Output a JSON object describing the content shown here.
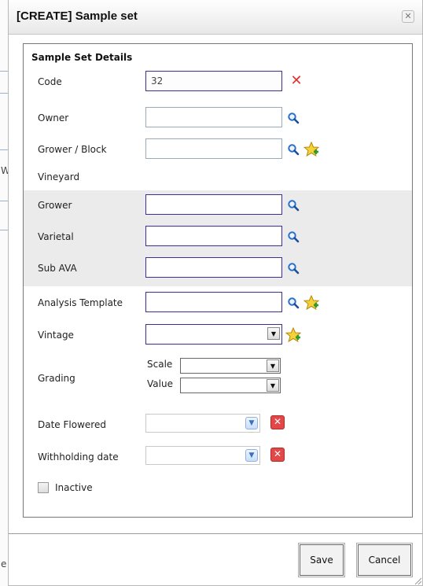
{
  "dialog": {
    "title": "[CREATE] Sample set",
    "section_title": "Sample Set Details"
  },
  "fields": {
    "code": {
      "label": "Code",
      "value": "32"
    },
    "owner": {
      "label": "Owner",
      "value": ""
    },
    "grower_block": {
      "label": "Grower / Block",
      "value": ""
    },
    "vineyard": {
      "label": "Vineyard"
    },
    "grower": {
      "label": "Grower",
      "value": ""
    },
    "varietal": {
      "label": "Varietal",
      "value": ""
    },
    "sub_ava": {
      "label": "Sub AVA",
      "value": ""
    },
    "analysis_template": {
      "label": "Analysis Template",
      "value": ""
    },
    "vintage": {
      "label": "Vintage",
      "value": ""
    },
    "grading": {
      "label": "Grading",
      "scale_label": "Scale",
      "value_label": "Value",
      "scale_value": "",
      "value_value": ""
    },
    "date_flowered": {
      "label": "Date Flowered",
      "value": ""
    },
    "withholding_date": {
      "label": "Withholding date",
      "value": ""
    },
    "inactive": {
      "label": "Inactive",
      "checked": false
    }
  },
  "buttons": {
    "save": "Save",
    "cancel": "Cancel"
  },
  "background": {
    "partial_text_w": "W",
    "partial_text_e": "e"
  },
  "colors": {
    "focus_border": "#3b2f96",
    "shaded_row": "#ebebeb",
    "clear_red": "#e24848"
  },
  "icons": [
    "close-icon",
    "clear-x-icon",
    "search-icon",
    "add-star-icon",
    "dropdown-arrow-icon",
    "clear-date-icon"
  ]
}
